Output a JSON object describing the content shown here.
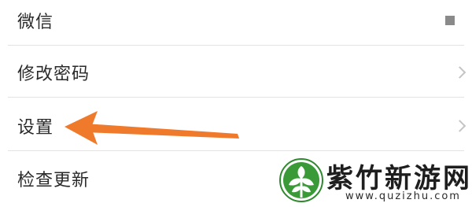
{
  "settings": {
    "items": [
      {
        "label": "微信",
        "icon": "square-icon"
      },
      {
        "label": "修改密码",
        "icon": "chevron-right-icon"
      },
      {
        "label": "设置",
        "icon": "chevron-right-icon"
      },
      {
        "label": "检查更新",
        "icon": ""
      }
    ]
  },
  "annotation": {
    "type": "arrow",
    "color": "#f07a2c",
    "points_to": "设置"
  },
  "watermark": {
    "title": "紫竹新游网",
    "url": "www.quzizhu.com",
    "logo_color": "#2f8a2f"
  }
}
